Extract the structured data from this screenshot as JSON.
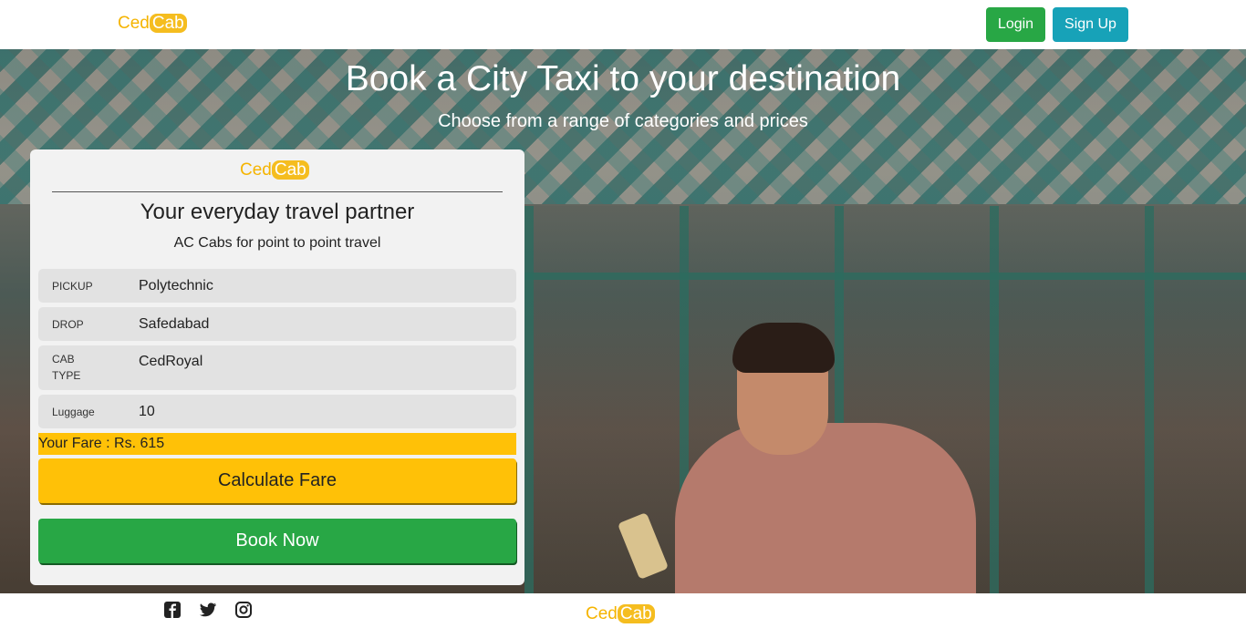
{
  "header": {
    "logo_part1": "Ced",
    "logo_part2": "Cab",
    "login_label": "Login",
    "signup_label": "Sign Up"
  },
  "hero": {
    "title": "Book a City Taxi to your destination",
    "subtitle": "Choose from a range of categories and prices"
  },
  "card": {
    "logo_part1": "Ced",
    "logo_part2": "Cab",
    "title": "Your everyday travel partner",
    "subtitle": "AC Cabs for point to point travel",
    "fields": [
      {
        "label": "PICKUP",
        "value": "Polytechnic"
      },
      {
        "label": "DROP",
        "value": "Safedabad"
      },
      {
        "label_line1": "CAB",
        "label_line2": "TYPE",
        "value": "CedRoyal"
      },
      {
        "label": "Luggage",
        "value": "10"
      }
    ],
    "fare_text": "Your Fare : Rs. 615",
    "calculate_label": "Calculate Fare",
    "book_label": "Book Now"
  },
  "footer": {
    "logo_part1": "Ced",
    "logo_part2": "Cab",
    "social_icons": [
      "facebook-icon",
      "twitter-icon",
      "instagram-icon"
    ]
  },
  "colors": {
    "brand_yellow": "#ffc107",
    "login_green": "#28a745",
    "signup_teal": "#17a2b8"
  }
}
